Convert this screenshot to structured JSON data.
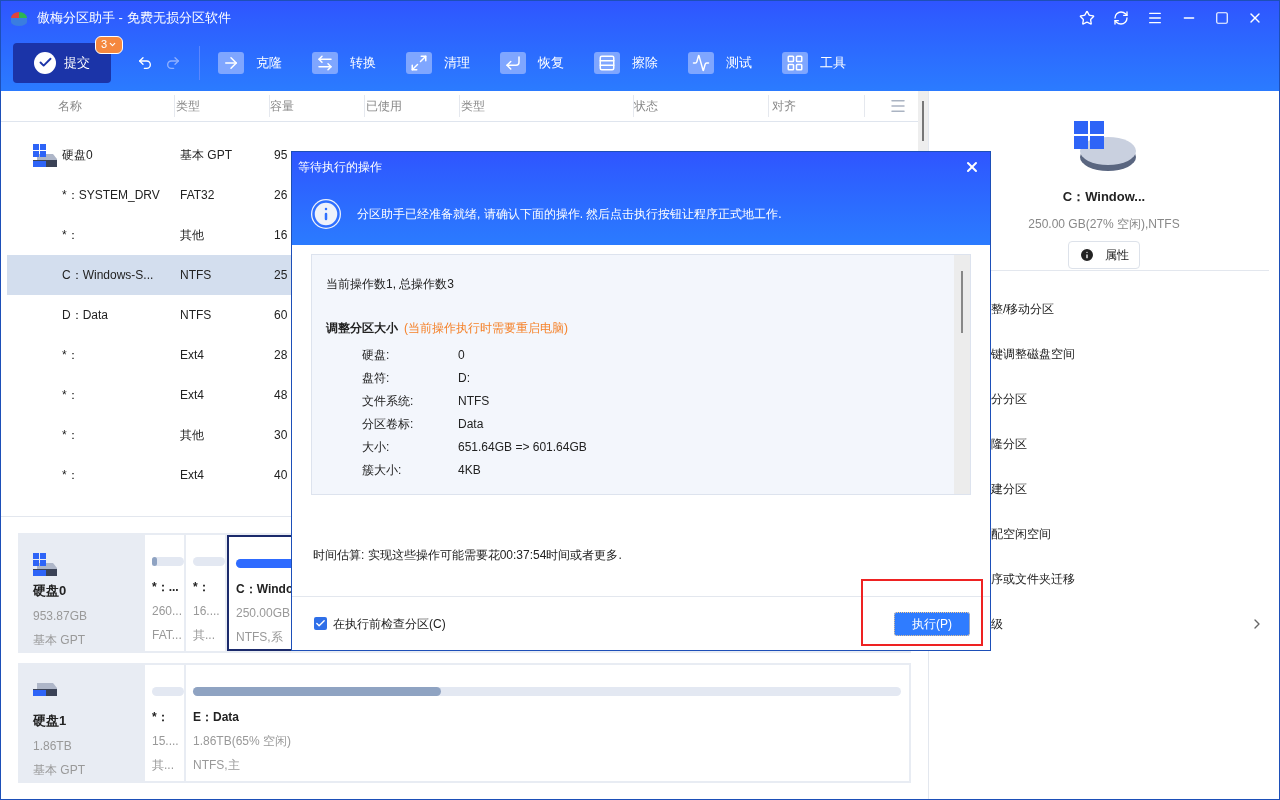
{
  "window": {
    "title": "傲梅分区助手 - 免费无损分区软件"
  },
  "toolbar": {
    "commit": {
      "label": "提交",
      "badge": "3"
    },
    "tools": [
      {
        "kind": "clone",
        "label": "克隆"
      },
      {
        "kind": "convert",
        "label": "转换"
      },
      {
        "kind": "clean",
        "label": "清理"
      },
      {
        "kind": "recover",
        "label": "恢复"
      },
      {
        "kind": "wipe",
        "label": "擦除"
      },
      {
        "kind": "test",
        "label": "测试"
      },
      {
        "kind": "tools",
        "label": "工具"
      }
    ]
  },
  "table": {
    "columns": [
      "名称",
      "类型",
      "容量",
      "已使用",
      "类型",
      "状态",
      "对齐"
    ],
    "rows": [
      {
        "kind": "disk",
        "name": "硬盘0",
        "type": "基本 GPT",
        "capacity": "95",
        "selected": false
      },
      {
        "kind": "partition",
        "name": "*：SYSTEM_DRV",
        "type": "FAT32",
        "capacity": "26",
        "selected": false
      },
      {
        "kind": "partition",
        "name": "*：",
        "type": "其他",
        "capacity": "16",
        "selected": false
      },
      {
        "kind": "partition",
        "name": "C：Windows-S...",
        "type": "NTFS",
        "capacity": "25",
        "selected": true
      },
      {
        "kind": "partition",
        "name": "D：Data",
        "type": "NTFS",
        "capacity": "60",
        "selected": false
      },
      {
        "kind": "partition",
        "name": "*：",
        "type": "Ext4",
        "capacity": "28",
        "selected": false
      },
      {
        "kind": "partition",
        "name": "*：",
        "type": "Ext4",
        "capacity": "48",
        "selected": false
      },
      {
        "kind": "partition",
        "name": "*：",
        "type": "其他",
        "capacity": "30",
        "selected": false
      },
      {
        "kind": "partition",
        "name": "*：",
        "type": "Ext4",
        "capacity": "40",
        "selected": false
      }
    ]
  },
  "disk_map": [
    {
      "name": "硬盘0",
      "size": "953.87GB",
      "style": "基本 GPT",
      "system": true,
      "partitions": [
        {
          "name": "*：...",
          "size": "260...",
          "fs": "FAT...",
          "level": 0.15,
          "selected": false
        },
        {
          "name": "*：",
          "size": "16....",
          "fs": "其...",
          "level": 0,
          "selected": false
        },
        {
          "name": "C：Windo",
          "size": "250.00GB",
          "fs": "NTFS,系",
          "level": 0.73,
          "selected": true
        }
      ]
    },
    {
      "name": "硬盘1",
      "size": "1.86TB",
      "style": "基本 GPT",
      "system": false,
      "partitions": [
        {
          "name": "*：",
          "size": "15....",
          "fs": "其...",
          "level": 0,
          "selected": false
        },
        {
          "name": "E：Data",
          "size": "1.86TB(65% 空闲)",
          "fs": "NTFS,主",
          "level": 0.35,
          "selected": false
        }
      ]
    }
  ],
  "details": {
    "name": "C：Window...",
    "info": "250.00 GB(27% 空闲),NTFS",
    "button": "属性"
  },
  "actions": [
    {
      "label": "整/移动分区",
      "submenu": false
    },
    {
      "label": "键调整磁盘空间",
      "submenu": false
    },
    {
      "label": "分分区",
      "submenu": false
    },
    {
      "label": "隆分区",
      "submenu": false
    },
    {
      "label": "建分区",
      "submenu": false
    },
    {
      "label": "配空闲空间",
      "submenu": false
    },
    {
      "label": "序或文件夹迁移",
      "submenu": false
    },
    {
      "label": "级",
      "submenu": true
    }
  ],
  "dialog": {
    "title": "等待执行的操作",
    "info": "分区助手已经准备就绪, 请确认下面的操作. 然后点击执行按钮让程序正式地工作.",
    "summary": "当前操作数1, 总操作数3",
    "operation": "调整分区大小",
    "note": "(当前操作执行时需要重启电脑)",
    "fields": [
      {
        "label": "硬盘:",
        "value": "0"
      },
      {
        "label": "盘符:",
        "value": "D:"
      },
      {
        "label": "文件系统:",
        "value": "NTFS"
      },
      {
        "label": "分区卷标:",
        "value": "Data"
      },
      {
        "label": "大小:",
        "value": "651.64GB => 601.64GB"
      },
      {
        "label": "簇大小:",
        "value": "4KB"
      }
    ],
    "estimate": "时间估算: 实现这些操作可能需要花00:37:54时间或者更多.",
    "check": {
      "label": "在执行前检查分区(C)",
      "checked": true
    },
    "execute": "执行(P)",
    "highlighted": true
  }
}
